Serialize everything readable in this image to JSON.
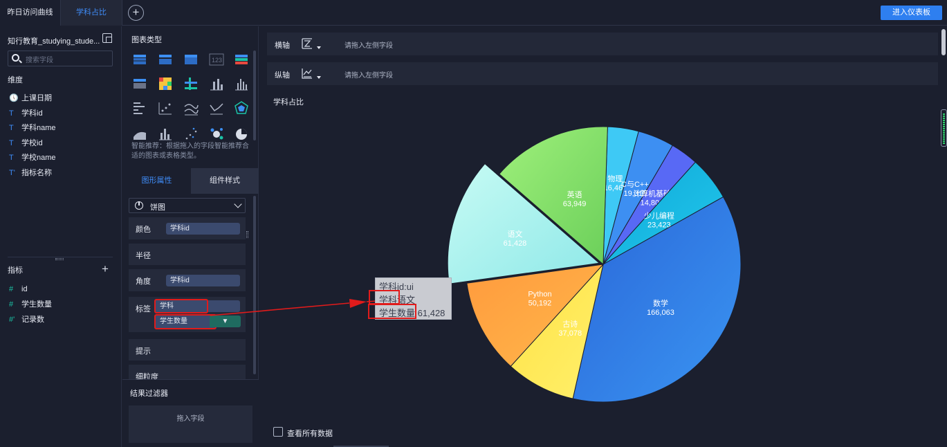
{
  "topbar": {
    "tabs": [
      "昨日访问曲线",
      "学科占比"
    ],
    "add_tab_label": "+",
    "enter_dashboard": "进入仪表板"
  },
  "left": {
    "dataset_name": "知行教育_studying_stude...",
    "search_placeholder": "搜索字段",
    "dimension_title": "维度",
    "dimensions": [
      {
        "icon": "clock",
        "glyph": "🕔",
        "label": "上课日期"
      },
      {
        "icon": "text",
        "glyph": "T",
        "label": "学科id"
      },
      {
        "icon": "text",
        "glyph": "T",
        "label": "学科name"
      },
      {
        "icon": "text",
        "glyph": "T",
        "label": "学校id"
      },
      {
        "icon": "text",
        "glyph": "T",
        "label": "学校name"
      },
      {
        "icon": "text-calc",
        "glyph": "T'",
        "label": "指标名称"
      }
    ],
    "metric_title": "指标",
    "metrics": [
      {
        "icon": "number",
        "glyph": "#",
        "label": "id"
      },
      {
        "icon": "number",
        "glyph": "#",
        "label": "学生数量"
      },
      {
        "icon": "number-calc",
        "glyph": "#'",
        "label": "记录数"
      }
    ]
  },
  "middle": {
    "chart_type_title": "图表类型",
    "smart_tip": "智能推荐：根据拖入的字段智能推荐合适的图表或表格类型。",
    "tabs": [
      "图形属性",
      "组件样式"
    ],
    "chart_select": "饼图",
    "props": {
      "color_label": "颜色",
      "color_field": "学科id",
      "radius_label": "半径",
      "angle_label": "角度",
      "angle_field": "学科id",
      "label_label": "标签",
      "label_field1": "学科",
      "label_field2": "学生数量",
      "tip_label": "提示",
      "granularity_label": "细粒度"
    },
    "result_filter_title": "结果过滤器",
    "drop_field": "拖入字段"
  },
  "main": {
    "x_axis_label": "横轴",
    "y_axis_label": "纵轴",
    "axis_placeholder": "请拖入左侧字段",
    "chart_title": "学科占比",
    "view_all": "查看所有数据"
  },
  "tooltip": {
    "line1": "学科id:ui",
    "line2_key": "学科",
    "line2_val": "语文",
    "line3_key": "学生数量",
    "line3_val": "61,428"
  },
  "chart_data": {
    "type": "pie",
    "title": "学科占比",
    "categories": [
      "物理",
      "C与C++",
      "计算机基础",
      "少儿编程",
      "数学",
      "古诗",
      "Python",
      "语文",
      "英语"
    ],
    "values": [
      16465,
      19311,
      14804,
      23423,
      166063,
      37078,
      50192,
      61428,
      63949
    ],
    "value_labels": [
      "16,465",
      "19,311",
      "14,804",
      "23,423",
      "166,063",
      "37,078",
      "50,192",
      "61,428",
      "63,949"
    ],
    "highlighted": "语文",
    "colors": [
      "#3ec9f5",
      "#3d8ff2",
      "#5869f5",
      "#27d9a8",
      "#13b7dc",
      "#2b78e4",
      "#ffe94f",
      "#ff9d3f",
      "#9bf0f0",
      "#8ae06f"
    ]
  }
}
